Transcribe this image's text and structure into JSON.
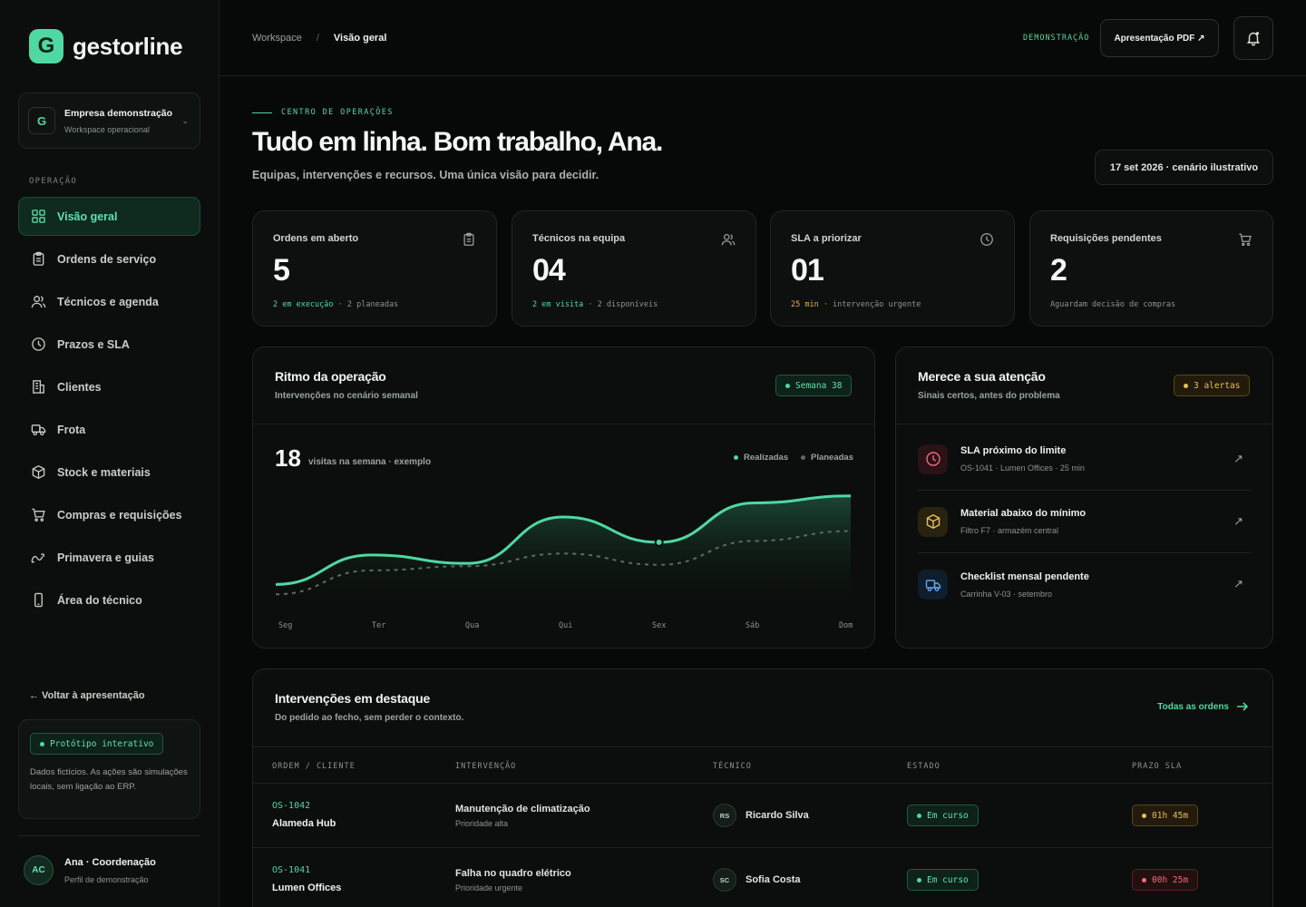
{
  "brand": {
    "letter": "G",
    "name": "gestorline"
  },
  "workspace": {
    "badge": "G",
    "name": "Empresa demonstração",
    "sub": "Workspace operacional",
    "caret": "⌄"
  },
  "sidebar": {
    "section": "OPERAÇÃO",
    "items": [
      {
        "label": "Visão geral",
        "icon": "grid-icon",
        "active": true
      },
      {
        "label": "Ordens de serviço",
        "icon": "clipboard-icon"
      },
      {
        "label": "Técnicos e agenda",
        "icon": "users-icon"
      },
      {
        "label": "Prazos e SLA",
        "icon": "clock-icon"
      },
      {
        "label": "Clientes",
        "icon": "building-icon"
      },
      {
        "label": "Frota",
        "icon": "truck-icon"
      },
      {
        "label": "Stock e materiais",
        "icon": "box-icon"
      },
      {
        "label": "Compras e requisições",
        "icon": "cart-icon"
      },
      {
        "label": "Primavera e guias",
        "icon": "route-icon"
      },
      {
        "label": "Área do técnico",
        "icon": "phone-icon"
      }
    ],
    "back": "← Voltar à apresentação",
    "proto": {
      "badge": "Protótipo interativo",
      "text": "Dados fictícios. As ações são simulações locais, sem ligação ao ERP."
    },
    "user": {
      "initials": "AC",
      "name": "Ana · Coordenação",
      "role": "Perfil de demonstração"
    }
  },
  "topbar": {
    "crumb1": "Workspace",
    "sep": "/",
    "crumb2": "Visão geral",
    "demo": "DEMONSTRAÇÃO",
    "pdf": "Apresentação PDF ↗"
  },
  "hero": {
    "eyebrow": "CENTRO DE OPERAÇÕES",
    "title": "Tudo em linha. Bom trabalho, Ana.",
    "subtitle": "Equipas, intervenções e recursos. Uma única visão para decidir.",
    "date": "17 set 2026 · cenário ilustrativo"
  },
  "kpis": [
    {
      "label": "Ordens em aberto",
      "value": "5",
      "foot_hl": "2 em execução",
      "foot_rest": "· 2 planeadas"
    },
    {
      "label": "Técnicos na equipa",
      "value": "04",
      "foot_hl": "2 em visita",
      "foot_rest": "· 2 disponíveis"
    },
    {
      "label": "SLA a priorizar",
      "value": "01",
      "foot_hl": "25 min",
      "foot_rest": "· intervenção urgente"
    },
    {
      "label": "Requisições pendentes",
      "value": "2",
      "foot_hl": "",
      "foot_rest": "Aguardam decisão de compras"
    }
  ],
  "rhythm": {
    "title": "Ritmo da operação",
    "subtitle": "Intervenções no cenário semanal",
    "week": "Semana 38",
    "total": "18",
    "total_caption": "visitas na semana · exemplo",
    "legend_done": "Realizadas",
    "legend_planned": "Planeadas",
    "colors": {
      "done": "#4fd8a2",
      "planned": "#5d6a63"
    }
  },
  "chart_data": {
    "type": "area",
    "categories": [
      "Seg",
      "Ter",
      "Qua",
      "Qui",
      "Sex",
      "Sáb",
      "Dom"
    ],
    "series": [
      {
        "name": "Realizadas",
        "values": [
          1.2,
          3.3,
          2.7,
          6.0,
          4.2,
          7.0,
          7.5
        ]
      },
      {
        "name": "Planeadas",
        "values": [
          0.5,
          2.2,
          2.5,
          3.4,
          2.6,
          4.3,
          5.0
        ]
      }
    ],
    "highlight_index": 4,
    "ylim": [
      0,
      8
    ],
    "grid": false
  },
  "attention": {
    "title": "Merece a sua atenção",
    "subtitle": "Sinais certos, antes do problema",
    "alerts_chip": "3 alertas",
    "items": [
      {
        "title": "SLA próximo do limite",
        "sub": "OS-1041 · Lumen Offices · 25 min",
        "icon": "clock-icon",
        "color": "#f06a77"
      },
      {
        "title": "Material abaixo do mínimo",
        "sub": "Filtro F7 · armazém central",
        "icon": "box-icon",
        "color": "#e8bf5a"
      },
      {
        "title": "Checklist mensal pendente",
        "sub": "Carrinha V-03 · setembro",
        "icon": "truck-icon",
        "color": "#5aa7f0"
      }
    ]
  },
  "featured": {
    "title": "Intervenções em destaque",
    "subtitle": "Do pedido ao fecho, sem perder o contexto.",
    "all_link": "Todas as ordens",
    "headers": [
      "ORDEM / CLIENTE",
      "INTERVENÇÃO",
      "TÉCNICO",
      "ESTADO",
      "PRAZO SLA"
    ],
    "rows": [
      {
        "order": "OS-1042",
        "client": "Alameda Hub",
        "title": "Manutenção de climatização",
        "priority": "Prioridade alta",
        "tech_initials": "RS",
        "tech": "Ricardo Silva",
        "status": "Em curso",
        "sla": "01h 45m",
        "sla_tone": "amber"
      },
      {
        "order": "OS-1041",
        "client": "Lumen Offices",
        "title": "Falha no quadro elétrico",
        "priority": "Prioridade urgente",
        "tech_initials": "SC",
        "tech": "Sofia Costa",
        "status": "Em curso",
        "sla": "00h 25m",
        "sla_tone": "red"
      }
    ]
  }
}
